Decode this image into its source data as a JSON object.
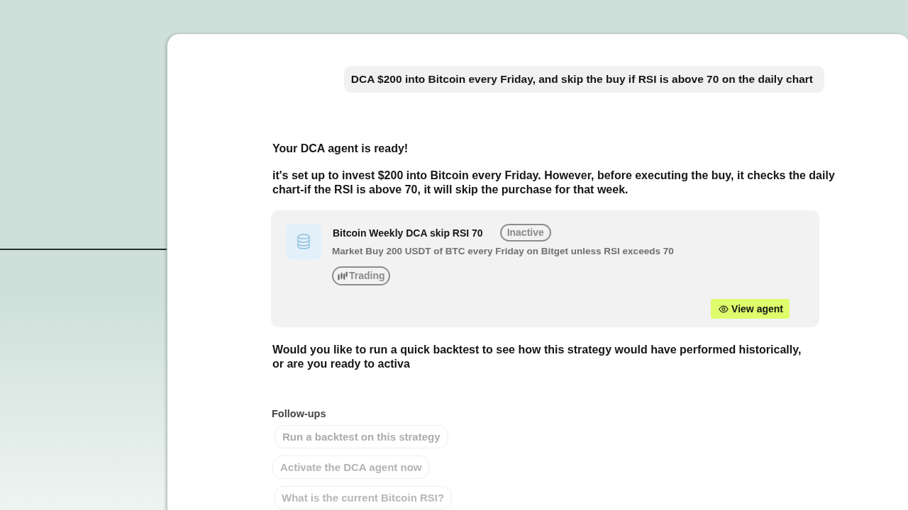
{
  "conversation": {
    "user_message": "DCA $200 into Bitcoin every Friday, and skip the buy if RSI is above 70 on the daily chart",
    "assistant": {
      "heading": "Your DCA agent is ready!",
      "paragraph": "it's set up to invest $200 into Bitcoin every Friday. However, before executing the buy, it checks the daily chart-if the RSI is above 70, it will skip the purchase for that week.",
      "agent_card": {
        "title": "Bitcoin Weekly DCA skip RSI 70",
        "status": "Inactive",
        "description": "Market Buy 200 USDT of BTC every Friday on Bitget unless RSI exceeds 70",
        "tag": "Trading",
        "action": "View agent"
      },
      "closing": "Would you like to run a quick backtest to see how this strategy would have performed historically, or are you ready to activa"
    },
    "follow_ups": {
      "label": "Follow-ups",
      "items": [
        "Run a backtest on this strategy",
        "Activate the DCA agent now",
        "What is the current Bitcoin RSI?"
      ]
    }
  }
}
